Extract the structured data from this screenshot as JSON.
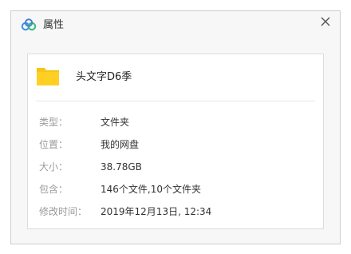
{
  "dialog": {
    "title": "属性",
    "close_glyph": "✕"
  },
  "item": {
    "name": "头文字D6季",
    "icon": "folder-icon",
    "icon_color": "#f5c518"
  },
  "properties": [
    {
      "label": "类型：",
      "value": "文件夹"
    },
    {
      "label": "位置：",
      "value": "我的网盘"
    },
    {
      "label": "大小：",
      "value": "38.78GB"
    },
    {
      "label": "包含：",
      "value": "146个文件,10个文件夹"
    },
    {
      "label": "修改时间：",
      "value": "2019年12月13日, 12:34"
    }
  ],
  "colors": {
    "brand": "#3a8ee6",
    "label_text": "#9a9a9a",
    "value_text": "#333333"
  }
}
